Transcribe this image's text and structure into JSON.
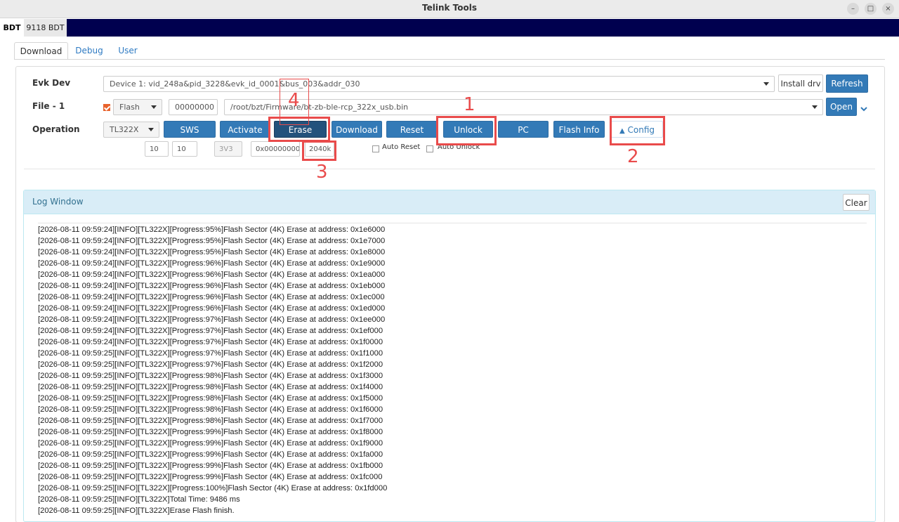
{
  "window": {
    "title": "Telink Tools"
  },
  "top_tabs": [
    {
      "label": "BDT"
    },
    {
      "label": "9118 BDT"
    }
  ],
  "sub_tabs": [
    {
      "label": "Download"
    },
    {
      "label": "Debug"
    },
    {
      "label": "User"
    }
  ],
  "evk": {
    "label": "Evk Dev",
    "device": "Device 1: vid_248a&pid_3228&evk_id_0001&bus_003&addr_030",
    "install_label": "Install drv",
    "refresh_label": "Refresh"
  },
  "file": {
    "label": "File - 1",
    "mode": "Flash",
    "address": "00000000",
    "path": "/root/bzt/Firmware/bt-zb-ble-rcp_322x_usb.bin",
    "open_label": "Open"
  },
  "operation": {
    "label": "Operation",
    "chip": "TL322X",
    "buttons": [
      "SWS",
      "Activate",
      "Erase",
      "Download",
      "Reset",
      "Unlock",
      "PC",
      "Flash Info"
    ],
    "config_label": "Config",
    "params": {
      "p1": "10",
      "p2": "10",
      "voltage": "3V3",
      "erase_addr": "0x00000000",
      "erase_size": "2040k"
    },
    "auto_reset": "Auto Reset",
    "auto_unlock": "Auto Unlock"
  },
  "log": {
    "title": "Log Window",
    "clear_label": "Clear",
    "lines": [
      "[2026-08-11 09:59:24][INFO][TL322X][Progress:95%]Flash Sector (4K) Erase at address: 0x1e6000",
      "[2026-08-11 09:59:24][INFO][TL322X][Progress:95%]Flash Sector (4K) Erase at address: 0x1e7000",
      "[2026-08-11 09:59:24][INFO][TL322X][Progress:95%]Flash Sector (4K) Erase at address: 0x1e8000",
      "[2026-08-11 09:59:24][INFO][TL322X][Progress:96%]Flash Sector (4K) Erase at address: 0x1e9000",
      "[2026-08-11 09:59:24][INFO][TL322X][Progress:96%]Flash Sector (4K) Erase at address: 0x1ea000",
      "[2026-08-11 09:59:24][INFO][TL322X][Progress:96%]Flash Sector (4K) Erase at address: 0x1eb000",
      "[2026-08-11 09:59:24][INFO][TL322X][Progress:96%]Flash Sector (4K) Erase at address: 0x1ec000",
      "[2026-08-11 09:59:24][INFO][TL322X][Progress:96%]Flash Sector (4K) Erase at address: 0x1ed000",
      "[2026-08-11 09:59:24][INFO][TL322X][Progress:97%]Flash Sector (4K) Erase at address: 0x1ee000",
      "[2026-08-11 09:59:24][INFO][TL322X][Progress:97%]Flash Sector (4K) Erase at address: 0x1ef000",
      "[2026-08-11 09:59:24][INFO][TL322X][Progress:97%]Flash Sector (4K) Erase at address: 0x1f0000",
      "[2026-08-11 09:59:25][INFO][TL322X][Progress:97%]Flash Sector (4K) Erase at address: 0x1f1000",
      "[2026-08-11 09:59:25][INFO][TL322X][Progress:97%]Flash Sector (4K) Erase at address: 0x1f2000",
      "[2026-08-11 09:59:25][INFO][TL322X][Progress:98%]Flash Sector (4K) Erase at address: 0x1f3000",
      "[2026-08-11 09:59:25][INFO][TL322X][Progress:98%]Flash Sector (4K) Erase at address: 0x1f4000",
      "[2026-08-11 09:59:25][INFO][TL322X][Progress:98%]Flash Sector (4K) Erase at address: 0x1f5000",
      "[2026-08-11 09:59:25][INFO][TL322X][Progress:98%]Flash Sector (4K) Erase at address: 0x1f6000",
      "[2026-08-11 09:59:25][INFO][TL322X][Progress:98%]Flash Sector (4K) Erase at address: 0x1f7000",
      "[2026-08-11 09:59:25][INFO][TL322X][Progress:99%]Flash Sector (4K) Erase at address: 0x1f8000",
      "[2026-08-11 09:59:25][INFO][TL322X][Progress:99%]Flash Sector (4K) Erase at address: 0x1f9000",
      "[2026-08-11 09:59:25][INFO][TL322X][Progress:99%]Flash Sector (4K) Erase at address: 0x1fa000",
      "[2026-08-11 09:59:25][INFO][TL322X][Progress:99%]Flash Sector (4K) Erase at address: 0x1fb000",
      "[2026-08-11 09:59:25][INFO][TL322X][Progress:99%]Flash Sector (4K) Erase at address: 0x1fc000",
      "[2026-08-11 09:59:25][INFO][TL322X][Progress:100%]Flash Sector (4K) Erase at address: 0x1fd000",
      "[2026-08-11 09:59:25][INFO][TL322X]Total Time: 9486 ms",
      "[2026-08-11 09:59:25][INFO][TL322X]Erase Flash finish."
    ]
  },
  "annotations": [
    "1",
    "2",
    "3",
    "4"
  ],
  "colors": {
    "accent": "#337ab7",
    "annotation": "#e94b4b",
    "top_strip": "#00004f"
  }
}
